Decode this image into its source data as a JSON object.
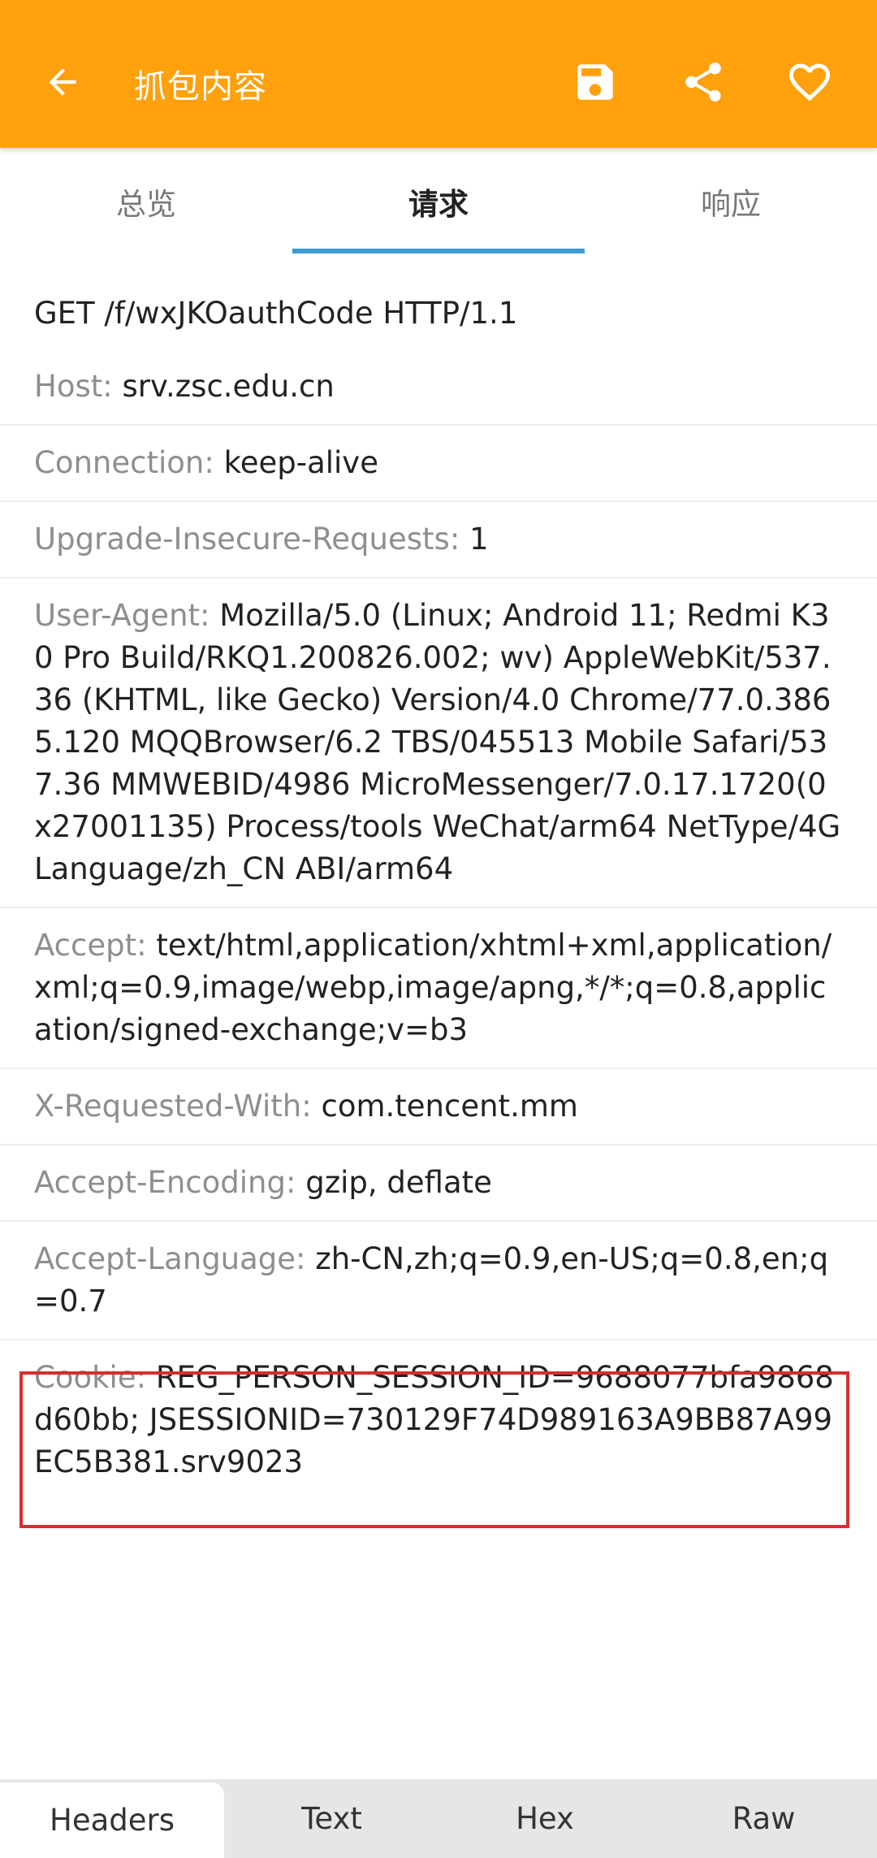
{
  "appbar": {
    "title": "抓包内容",
    "icons": [
      "arrow-back-icon",
      "save-icon",
      "share-icon",
      "heart-icon"
    ],
    "color": "#FFA00D"
  },
  "tabs": [
    {
      "label": "总览"
    },
    {
      "label": "请求",
      "active": true
    },
    {
      "label": "响应"
    }
  ],
  "request": {
    "request_line": "GET /f/wxJKOauthCode HTTP/1.1",
    "headers": [
      {
        "key": "Host:",
        "value": "srv.zsc.edu.cn"
      },
      {
        "key": "Connection:",
        "value": "keep-alive"
      },
      {
        "key": "Upgrade-Insecure-Requests:",
        "value": "1"
      },
      {
        "key": "User-Agent:",
        "value": "Mozilla/5.0 (Linux; Android 11; Redmi K30 Pro Build/RKQ1.200826.002; wv) AppleWebKit/537.36 (KHTML, like Gecko) Version/4.0 Chrome/77.0.3865.120 MQQBrowser/6.2 TBS/045513 Mobile Safari/537.36 MMWEBID/4986 MicroMessenger/7.0.17.1720(0x27001135) Process/tools WeChat/arm64 NetType/4G Language/zh_CN ABI/arm64"
      },
      {
        "key": "Accept:",
        "value": "text/html,application/xhtml+xml,application/xml;q=0.9,image/webp,image/apng,*/*;q=0.8,application/signed-exchange;v=b3"
      },
      {
        "key": "X-Requested-With:",
        "value": "com.tencent.mm"
      },
      {
        "key": "Accept-Encoding:",
        "value": "gzip, deflate"
      },
      {
        "key": "Accept-Language:",
        "value": "zh-CN,zh;q=0.9,en-US;q=0.8,en;q=0.7"
      },
      {
        "key": "Cookie:",
        "value": "REG_PERSON_SESSION_ID=9688077bfa9868d60bb; JSESSIONID=730129F74D989163A9BB87A99EC5B381.srv9023"
      }
    ]
  },
  "bottom_tabs": [
    {
      "label": "Headers",
      "active": true
    },
    {
      "label": "Text"
    },
    {
      "label": "Hex"
    },
    {
      "label": "Raw"
    }
  ],
  "colors": {
    "accent": "#FFA00D",
    "tab_indicator": "#3E9BD0",
    "highlight_border": "#D32F2F",
    "header_key": "#8E8E8E"
  }
}
